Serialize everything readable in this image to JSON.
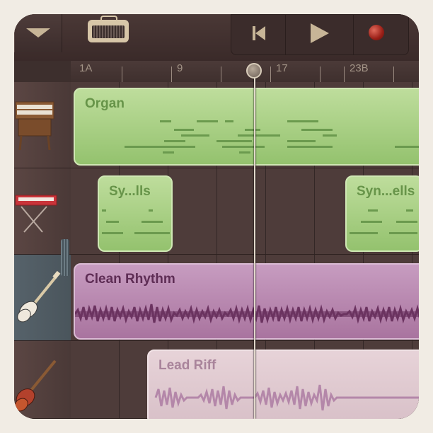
{
  "toolbar": {
    "menu_icon": "triangle-down-icon",
    "instrument_icon": "amplifier-icon",
    "rewind_icon": "rewind-icon",
    "play_icon": "play-icon",
    "record_icon": "record-icon"
  },
  "ruler": {
    "markers": [
      "1A",
      "9",
      "17",
      "23B"
    ]
  },
  "tracks": [
    {
      "instrument": "organ-icon"
    },
    {
      "instrument": "synth-keyboard-icon"
    },
    {
      "instrument": "electric-guitar-icon",
      "selected": true
    },
    {
      "instrument": "electric-guitar-lead-icon"
    }
  ],
  "regions": {
    "organ": "Organ",
    "synth_1": "Sy...lls",
    "synth_2": "Syn...ells",
    "clean_rhythm": "Clean Rhythm",
    "lead_riff": "Lead Riff"
  },
  "colors": {
    "software_instrument": "#a8cf85",
    "audio_selected": "#b888ae",
    "audio": "#e0ccd2",
    "background": "#4e3c3a"
  }
}
